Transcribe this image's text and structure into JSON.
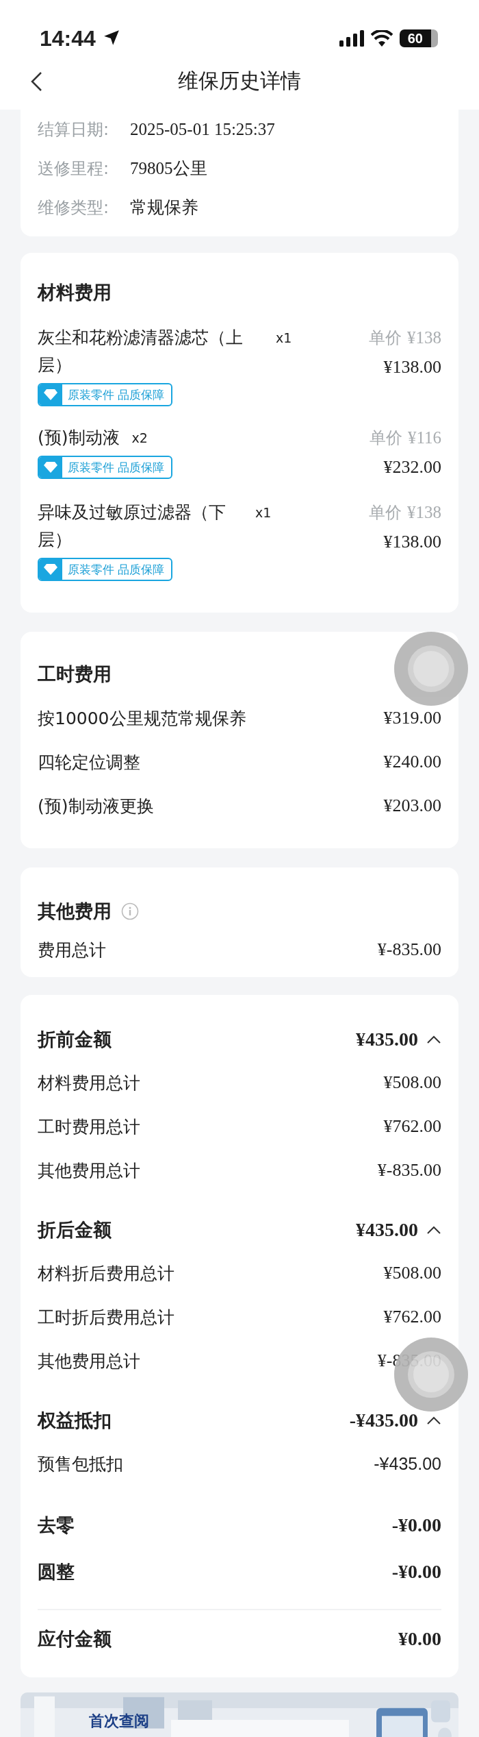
{
  "status_bar": {
    "time": "14:44",
    "battery": "60"
  },
  "nav": {
    "title": "维保历史详情"
  },
  "info": [
    {
      "label": "结算日期:",
      "value": "2025-05-01 15:25:37"
    },
    {
      "label": "送修里程:",
      "value": "79805公里"
    },
    {
      "label": "维修类型:",
      "value": "常规保养"
    }
  ],
  "materials": {
    "title": "材料费用",
    "items": [
      {
        "name": "灰尘和花粉滤清器滤芯（上层）",
        "qty": "x1",
        "unit_label": "单价",
        "unit_price": "¥138",
        "total": "¥138.00",
        "badge": "原装零件 品质保障"
      },
      {
        "name": "(预)制动液",
        "qty": "x2",
        "unit_label": "单价",
        "unit_price": "¥116",
        "total": "¥232.00",
        "badge": "原装零件 品质保障"
      },
      {
        "name": "异味及过敏原过滤器（下层）",
        "qty": "x1",
        "unit_label": "单价",
        "unit_price": "¥138",
        "total": "¥138.00",
        "badge": "原装零件 品质保障"
      }
    ]
  },
  "labor": {
    "title": "工时费用",
    "items": [
      {
        "name": "按10000公里规范常规保养",
        "amount": "¥319.00"
      },
      {
        "name": "四轮定位调整",
        "amount": "¥240.00"
      },
      {
        "name": "(预)制动液更换",
        "amount": "¥203.00"
      }
    ]
  },
  "other": {
    "title": "其他费用",
    "rows": [
      {
        "name": "费用总计",
        "amount": "¥-835.00"
      }
    ]
  },
  "summary": {
    "groups": [
      {
        "title": "折前金额",
        "amount": "¥435.00",
        "expanded": true,
        "rows": [
          {
            "name": "材料费用总计",
            "amount": "¥508.00"
          },
          {
            "name": "工时费用总计",
            "amount": "¥762.00"
          },
          {
            "name": "其他费用总计",
            "amount": "¥-835.00"
          }
        ]
      },
      {
        "title": "折后金额",
        "amount": "¥435.00",
        "expanded": true,
        "rows": [
          {
            "name": "材料折后费用总计",
            "amount": "¥508.00"
          },
          {
            "name": "工时折后费用总计",
            "amount": "¥762.00"
          },
          {
            "name": "其他费用总计",
            "amount": "¥-835.00"
          }
        ]
      },
      {
        "title": "权益抵扣",
        "amount": "-¥435.00",
        "expanded": true,
        "rows": [
          {
            "name": "预售包抵扣",
            "amount": "-¥435.00"
          }
        ]
      }
    ],
    "adjustments": [
      {
        "name": "去零",
        "amount": "-¥0.00"
      },
      {
        "name": "圆整",
        "amount": "-¥0.00"
      }
    ],
    "payable": {
      "name": "应付金额",
      "amount": "¥0.00"
    }
  },
  "banner": {
    "kind": "picture",
    "text": "首次查阅"
  }
}
